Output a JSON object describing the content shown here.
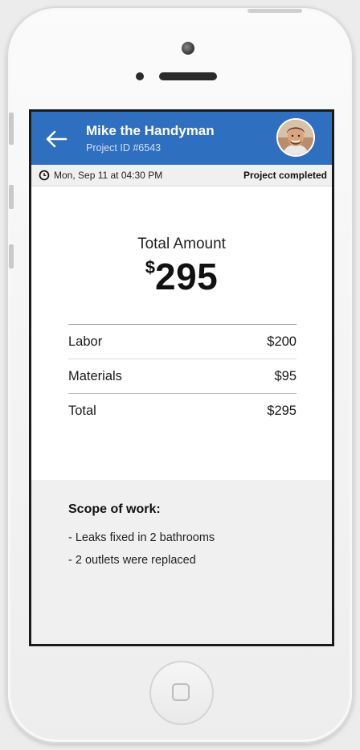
{
  "header": {
    "title": "Mike the Handyman",
    "project_id": "Project ID #6543",
    "back_icon": "arrow-left-icon",
    "avatar_icon": "contact-avatar",
    "bg_color": "#2f6fbf"
  },
  "info_bar": {
    "clock_icon": "clock-icon",
    "datetime": "Mon, Sep 11 at 04:30 PM",
    "status": "Project completed"
  },
  "summary": {
    "label": "Total Amount",
    "currency": "$",
    "value": "295"
  },
  "line_items": [
    {
      "label": "Labor",
      "amount": "$200"
    },
    {
      "label": "Materials",
      "amount": "$95"
    },
    {
      "label": "Total",
      "amount": "$295"
    }
  ],
  "scope": {
    "title": "Scope of work:",
    "items": [
      "- Leaks fixed in 2 bathrooms",
      "- 2 outlets were replaced"
    ]
  },
  "device": {
    "home_icon": "home-button"
  }
}
